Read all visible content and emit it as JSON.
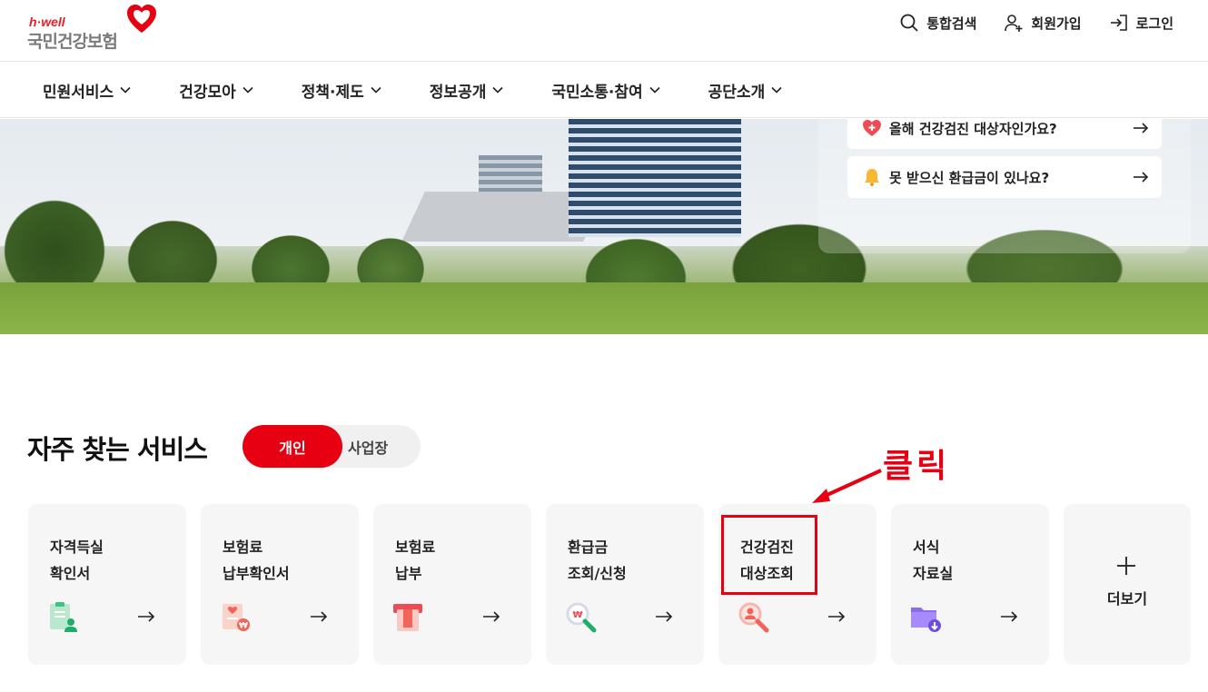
{
  "logo": {
    "tagline": "h·well",
    "name": "국민건강보험"
  },
  "util": [
    {
      "label": "통합검색",
      "icon": "search-icon"
    },
    {
      "label": "회원가입",
      "icon": "user-plus-icon"
    },
    {
      "label": "로그인",
      "icon": "login-icon"
    }
  ],
  "gnb": [
    {
      "label": "민원서비스"
    },
    {
      "label": "건강모아"
    },
    {
      "label": "정책·제도"
    },
    {
      "label": "정보공개"
    },
    {
      "label": "국민소통·참여"
    },
    {
      "label": "공단소개"
    }
  ],
  "hero": {
    "quick": [
      {
        "label": "올해 건강검진 대상자인가요?",
        "icon": "heart-plus-icon"
      },
      {
        "label": "못 받으신 환급금이 있나요?",
        "icon": "bell-icon"
      }
    ]
  },
  "services": {
    "title": "자주 찾는 서비스",
    "toggle": {
      "on": "개인",
      "off": "사업장"
    },
    "cards": [
      {
        "label": "자격득실\n확인서",
        "icon": "clipboard-user-icon"
      },
      {
        "label": "보험료\n납부확인서",
        "icon": "receipt-won-icon"
      },
      {
        "label": "보험료\n납부",
        "icon": "card-payment-icon"
      },
      {
        "label": "환급금\n조회/신청",
        "icon": "search-won-icon"
      },
      {
        "label": "건강검진\n대상조회",
        "icon": "search-person-icon"
      },
      {
        "label": "서식\n자료실",
        "icon": "folder-download-icon"
      }
    ],
    "more": "더보기"
  },
  "annotation": {
    "text": "클릭"
  },
  "colors": {
    "brand": "#e60012",
    "card_bg": "#f6f6f6"
  }
}
